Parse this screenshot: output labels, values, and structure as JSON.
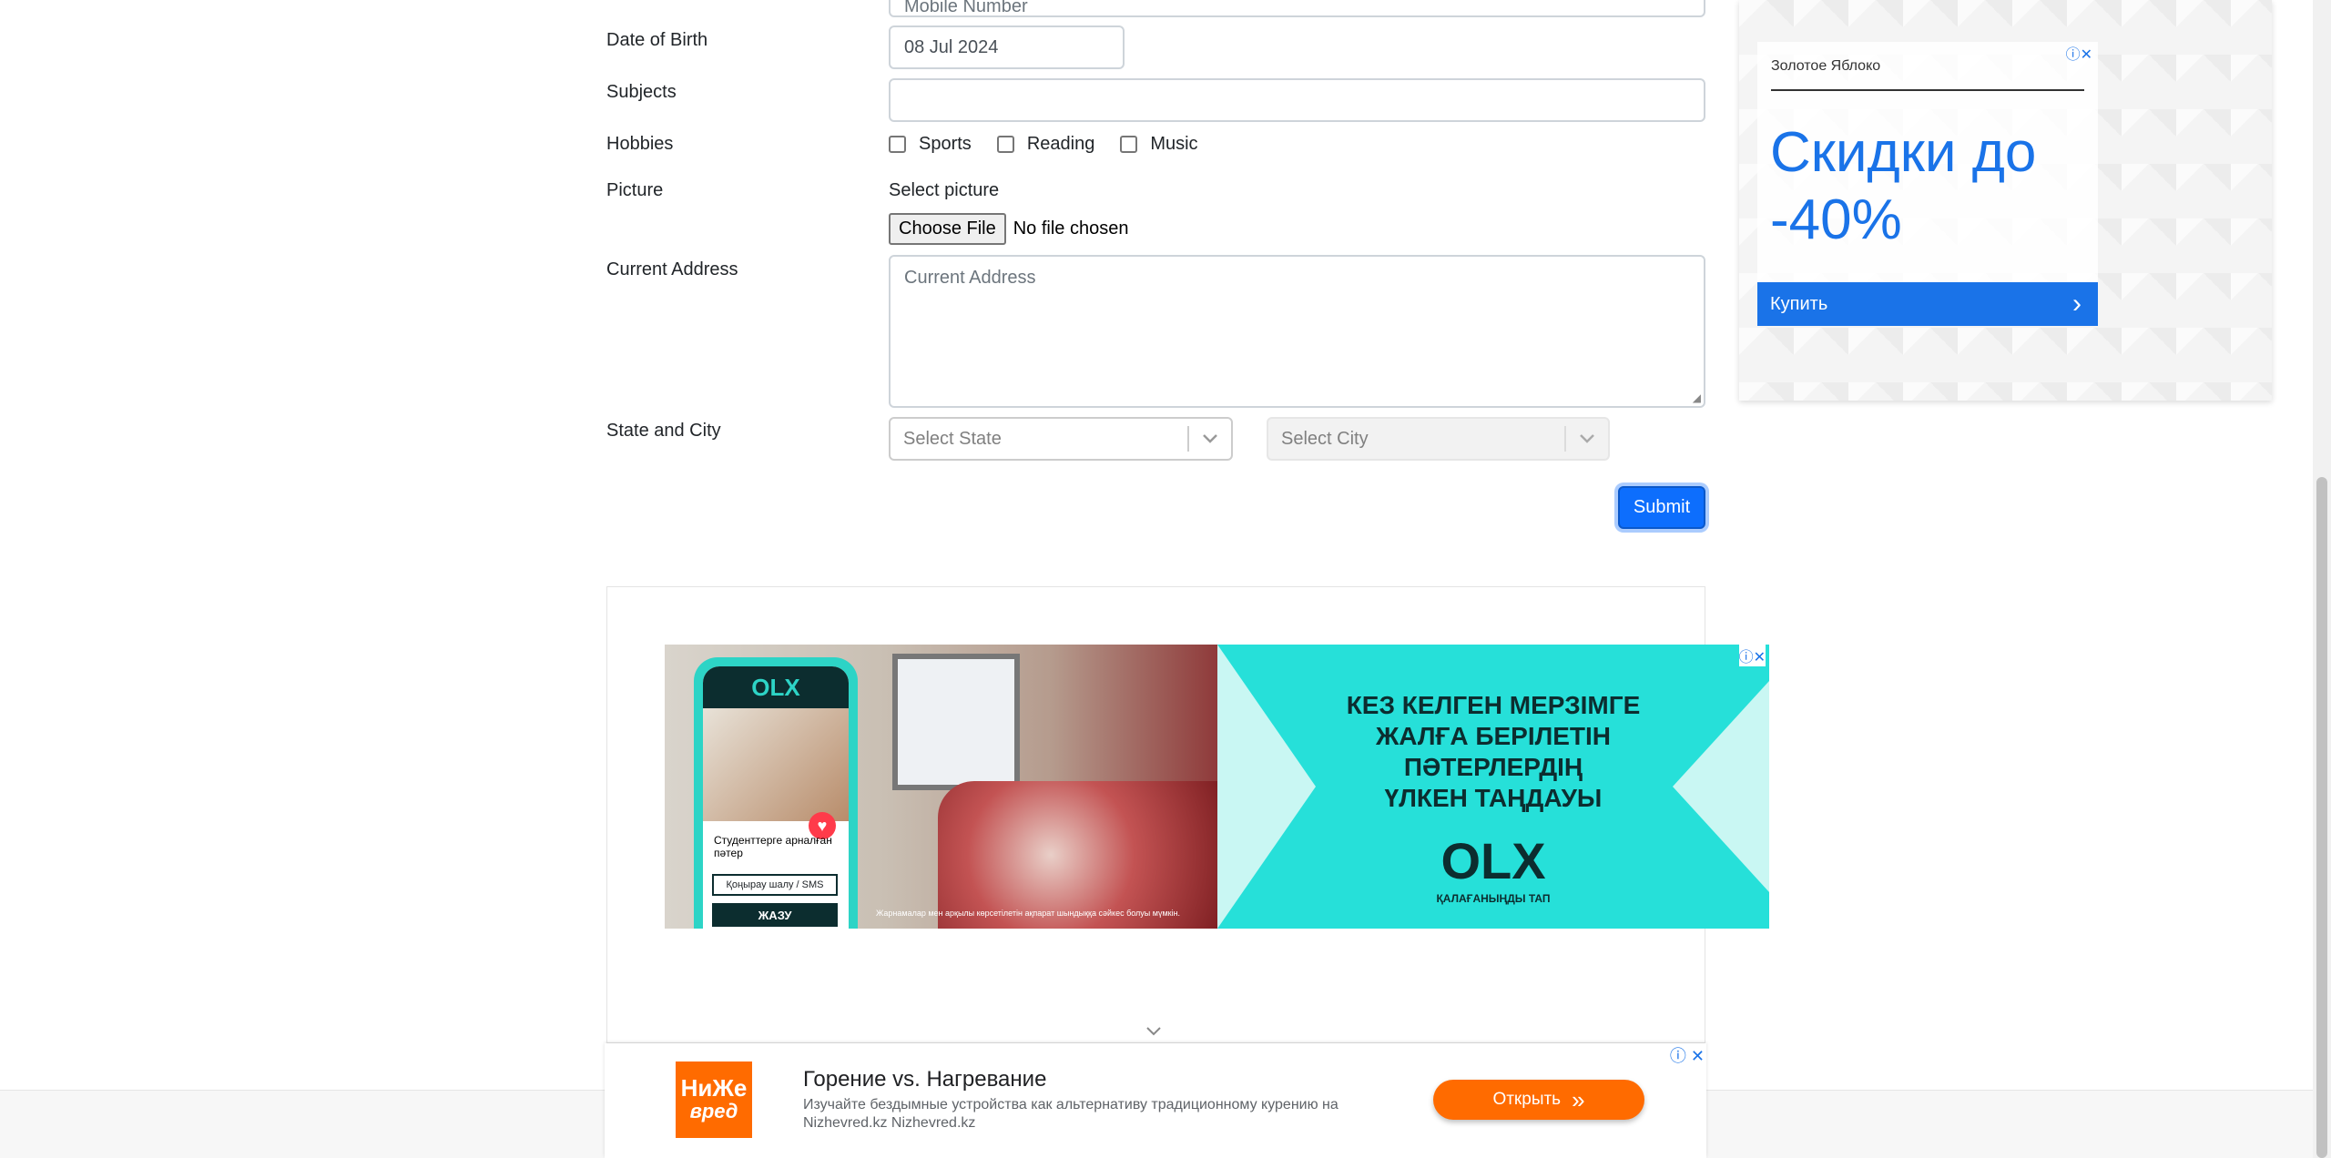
{
  "form": {
    "mobile_placeholder": "Mobile Number",
    "dob_label": "Date of Birth",
    "dob_value": "08 Jul 2024",
    "subjects_label": "Subjects",
    "hobbies_label": "Hobbies",
    "hobbies": [
      "Sports",
      "Reading",
      "Music"
    ],
    "picture_label": "Picture",
    "select_picture": "Select picture",
    "choose_file": "Choose File",
    "no_file": "No file chosen",
    "address_label": "Current Address",
    "address_placeholder": "Current Address",
    "state_city_label": "State and City",
    "state_placeholder": "Select State",
    "city_placeholder": "Select City",
    "submit_label": "Submit"
  },
  "side_ad": {
    "brand": "Золотое Яблоко",
    "headline_line1": "Скидки до",
    "headline_line2": "-40%",
    "cta": "Купить",
    "chevron": "›",
    "accent": "#1a73e8"
  },
  "olx_ad": {
    "headline": [
      "КЕЗ КЕЛГЕН МЕРЗІМГЕ",
      "ЖАЛҒА БЕРІЛЕТІН",
      "ПӘТЕРЛЕРДІҢ",
      "ҮЛКЕН ТАҢДАУЫ"
    ],
    "logo": "OLX",
    "tagline": "ҚАЛАҒАНЫҢДЫ ТАП",
    "phone_title": "Студенттерге арналған пәтер",
    "phone_call": "Қоңырау шалу / SMS",
    "phone_write": "ЖАЗУ",
    "disclaimer": "Жарнамалар мен арқылы көрсетілетін ақпарат шындыққа сәйкес болуы мүмкін.",
    "accent": "#26e0d9"
  },
  "bottom_ad": {
    "title": "Горение vs. Нагревание",
    "desc": "Изучайте бездымные устройства как альтернативу традиционному курению на Nizhevred.kz Nizhevred.kz",
    "logo_line1": "НиЖе",
    "logo_line2": "вред",
    "open_label": "Открыть",
    "open_arrows": "»",
    "accent": "#ff6b00"
  }
}
